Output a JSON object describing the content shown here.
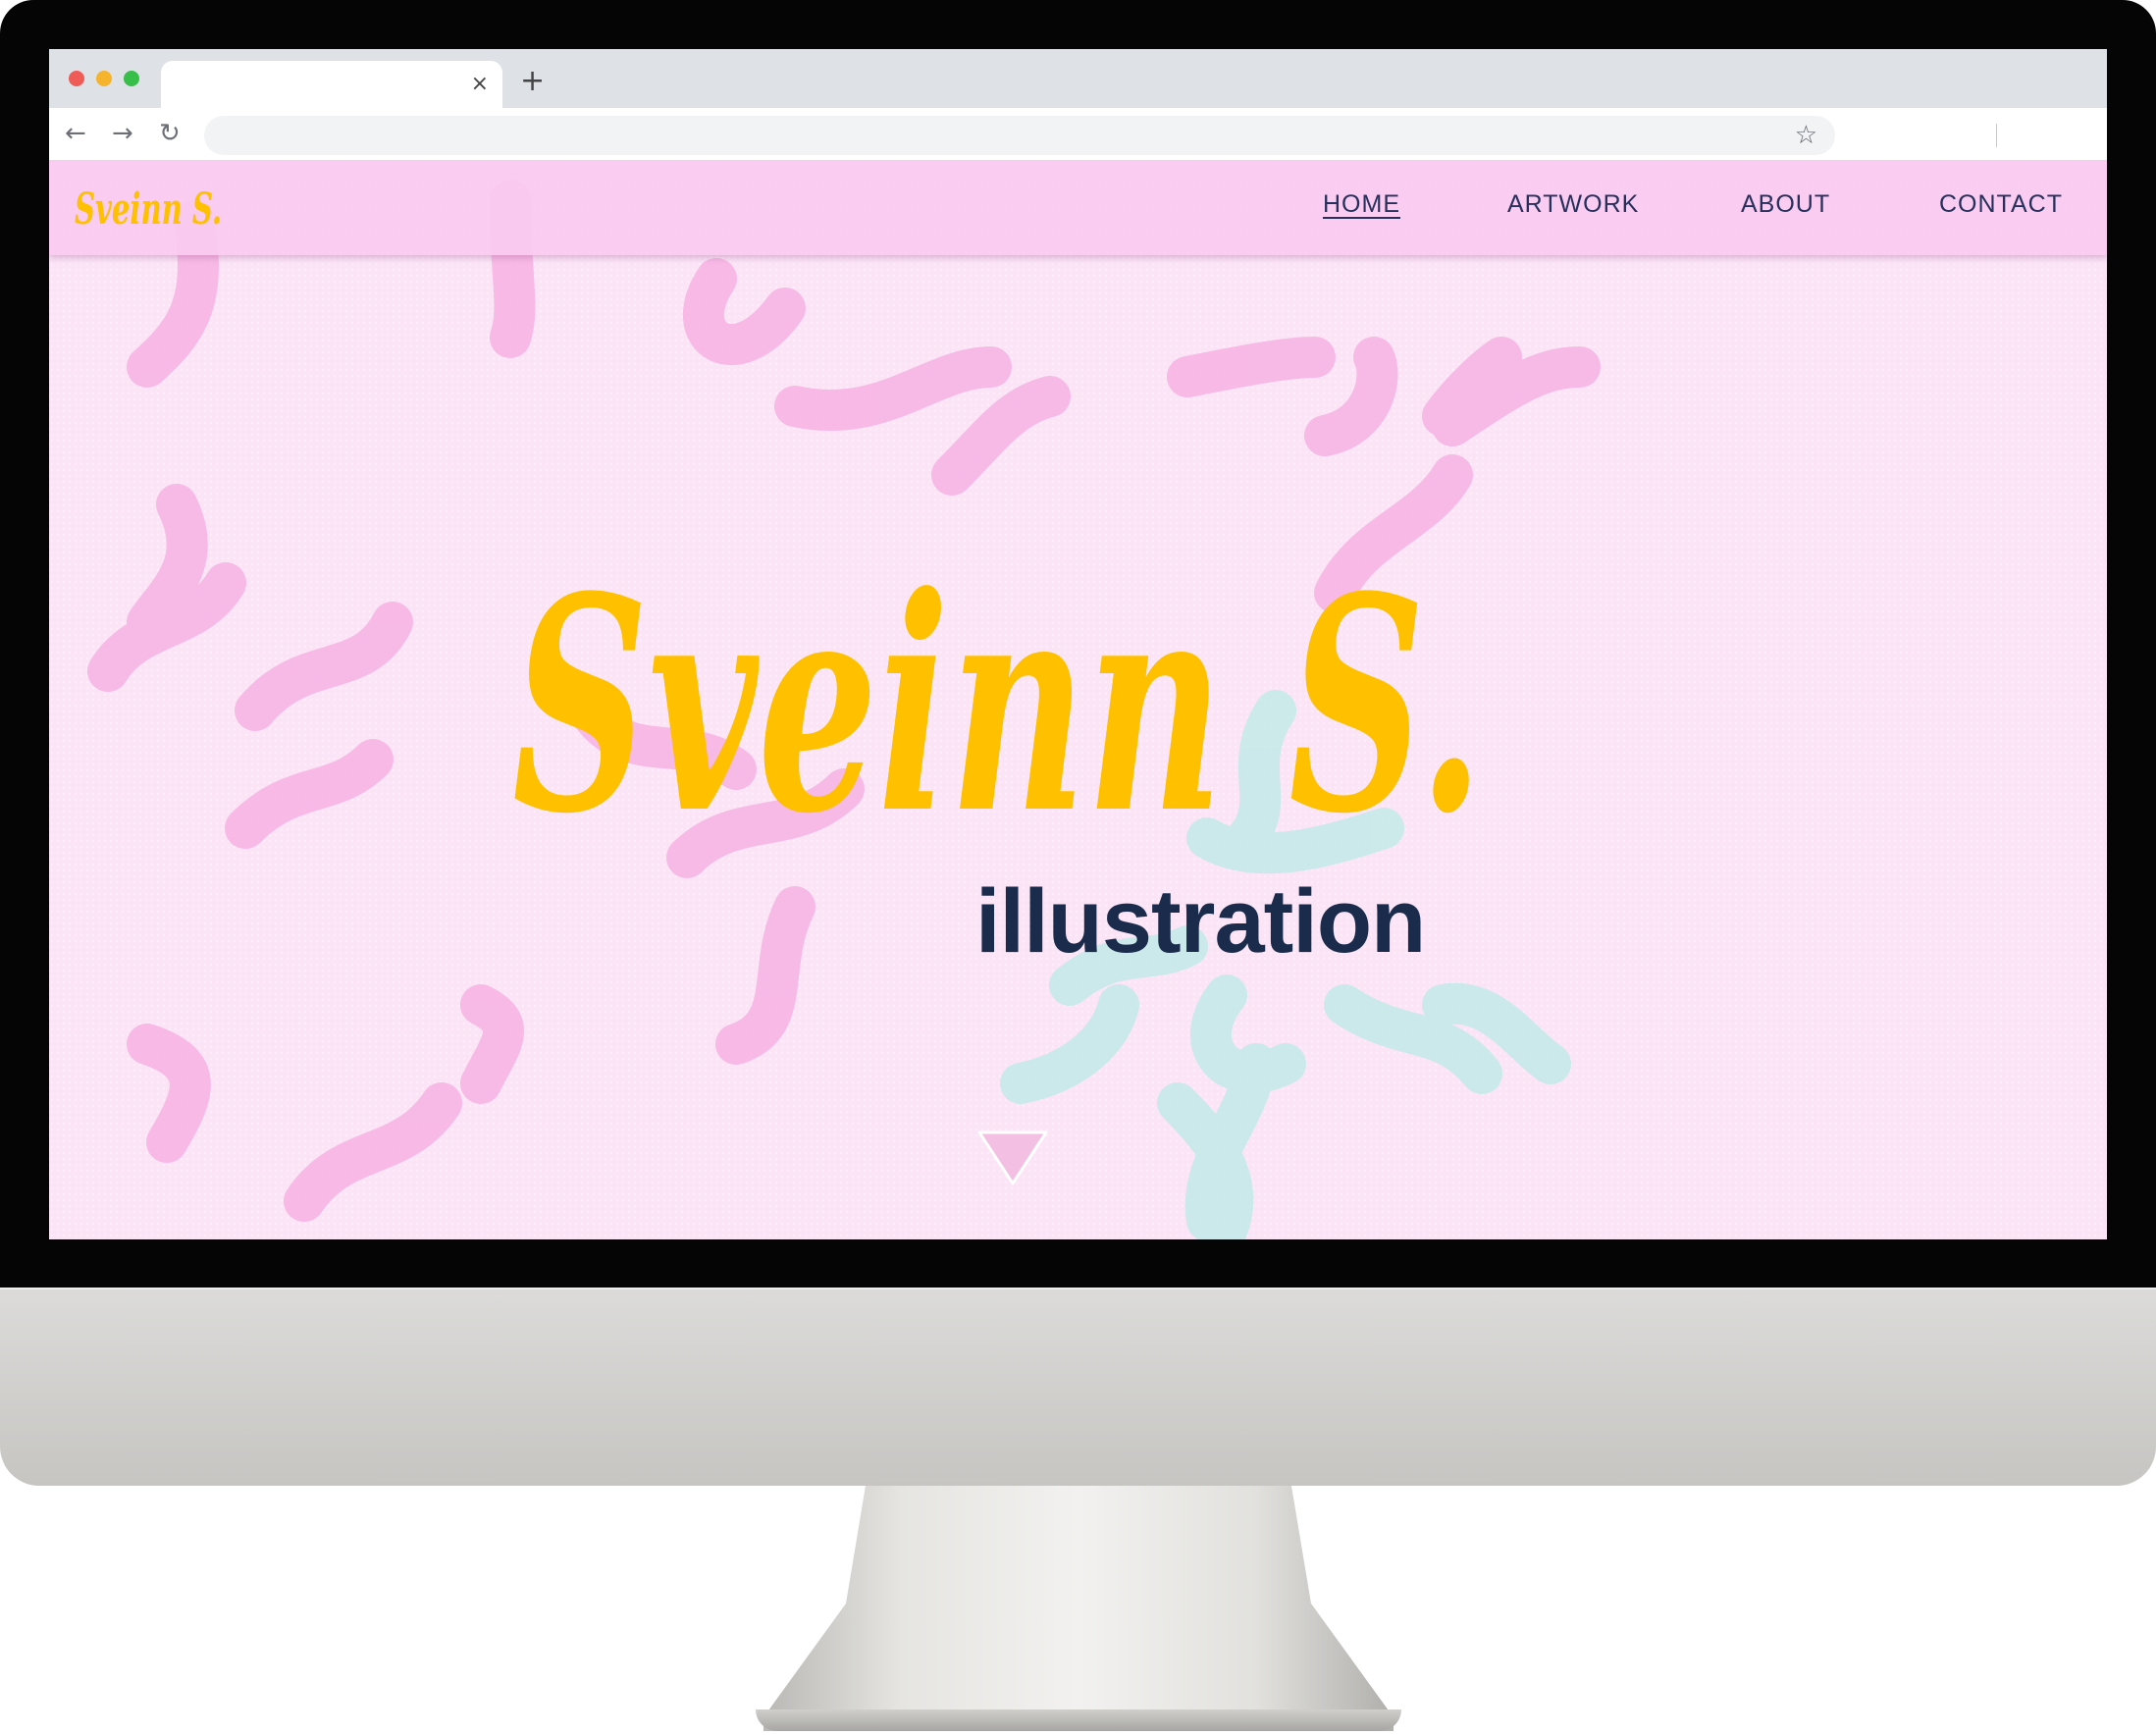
{
  "browser": {
    "tab_close": "×",
    "new_tab": "+",
    "back": "←",
    "forward": "→",
    "reload": "↻",
    "bookmark": "☆"
  },
  "site": {
    "logo_text": "Sveinn S.",
    "nav": {
      "home": "HOME",
      "artwork": "ARTWORK",
      "about": "ABOUT",
      "contact": "CONTACT"
    },
    "hero_title": "Sveinn S.",
    "hero_subtitle": "illustration"
  },
  "colors": {
    "background": "#fbe4f6",
    "navbar": "#facaf0",
    "logo_yellow": "#ffc000",
    "subtitle_navy": "#1b2b4c",
    "squiggle_pink": "#f7b2e3",
    "squiggle_mint": "#c3ebe8"
  }
}
